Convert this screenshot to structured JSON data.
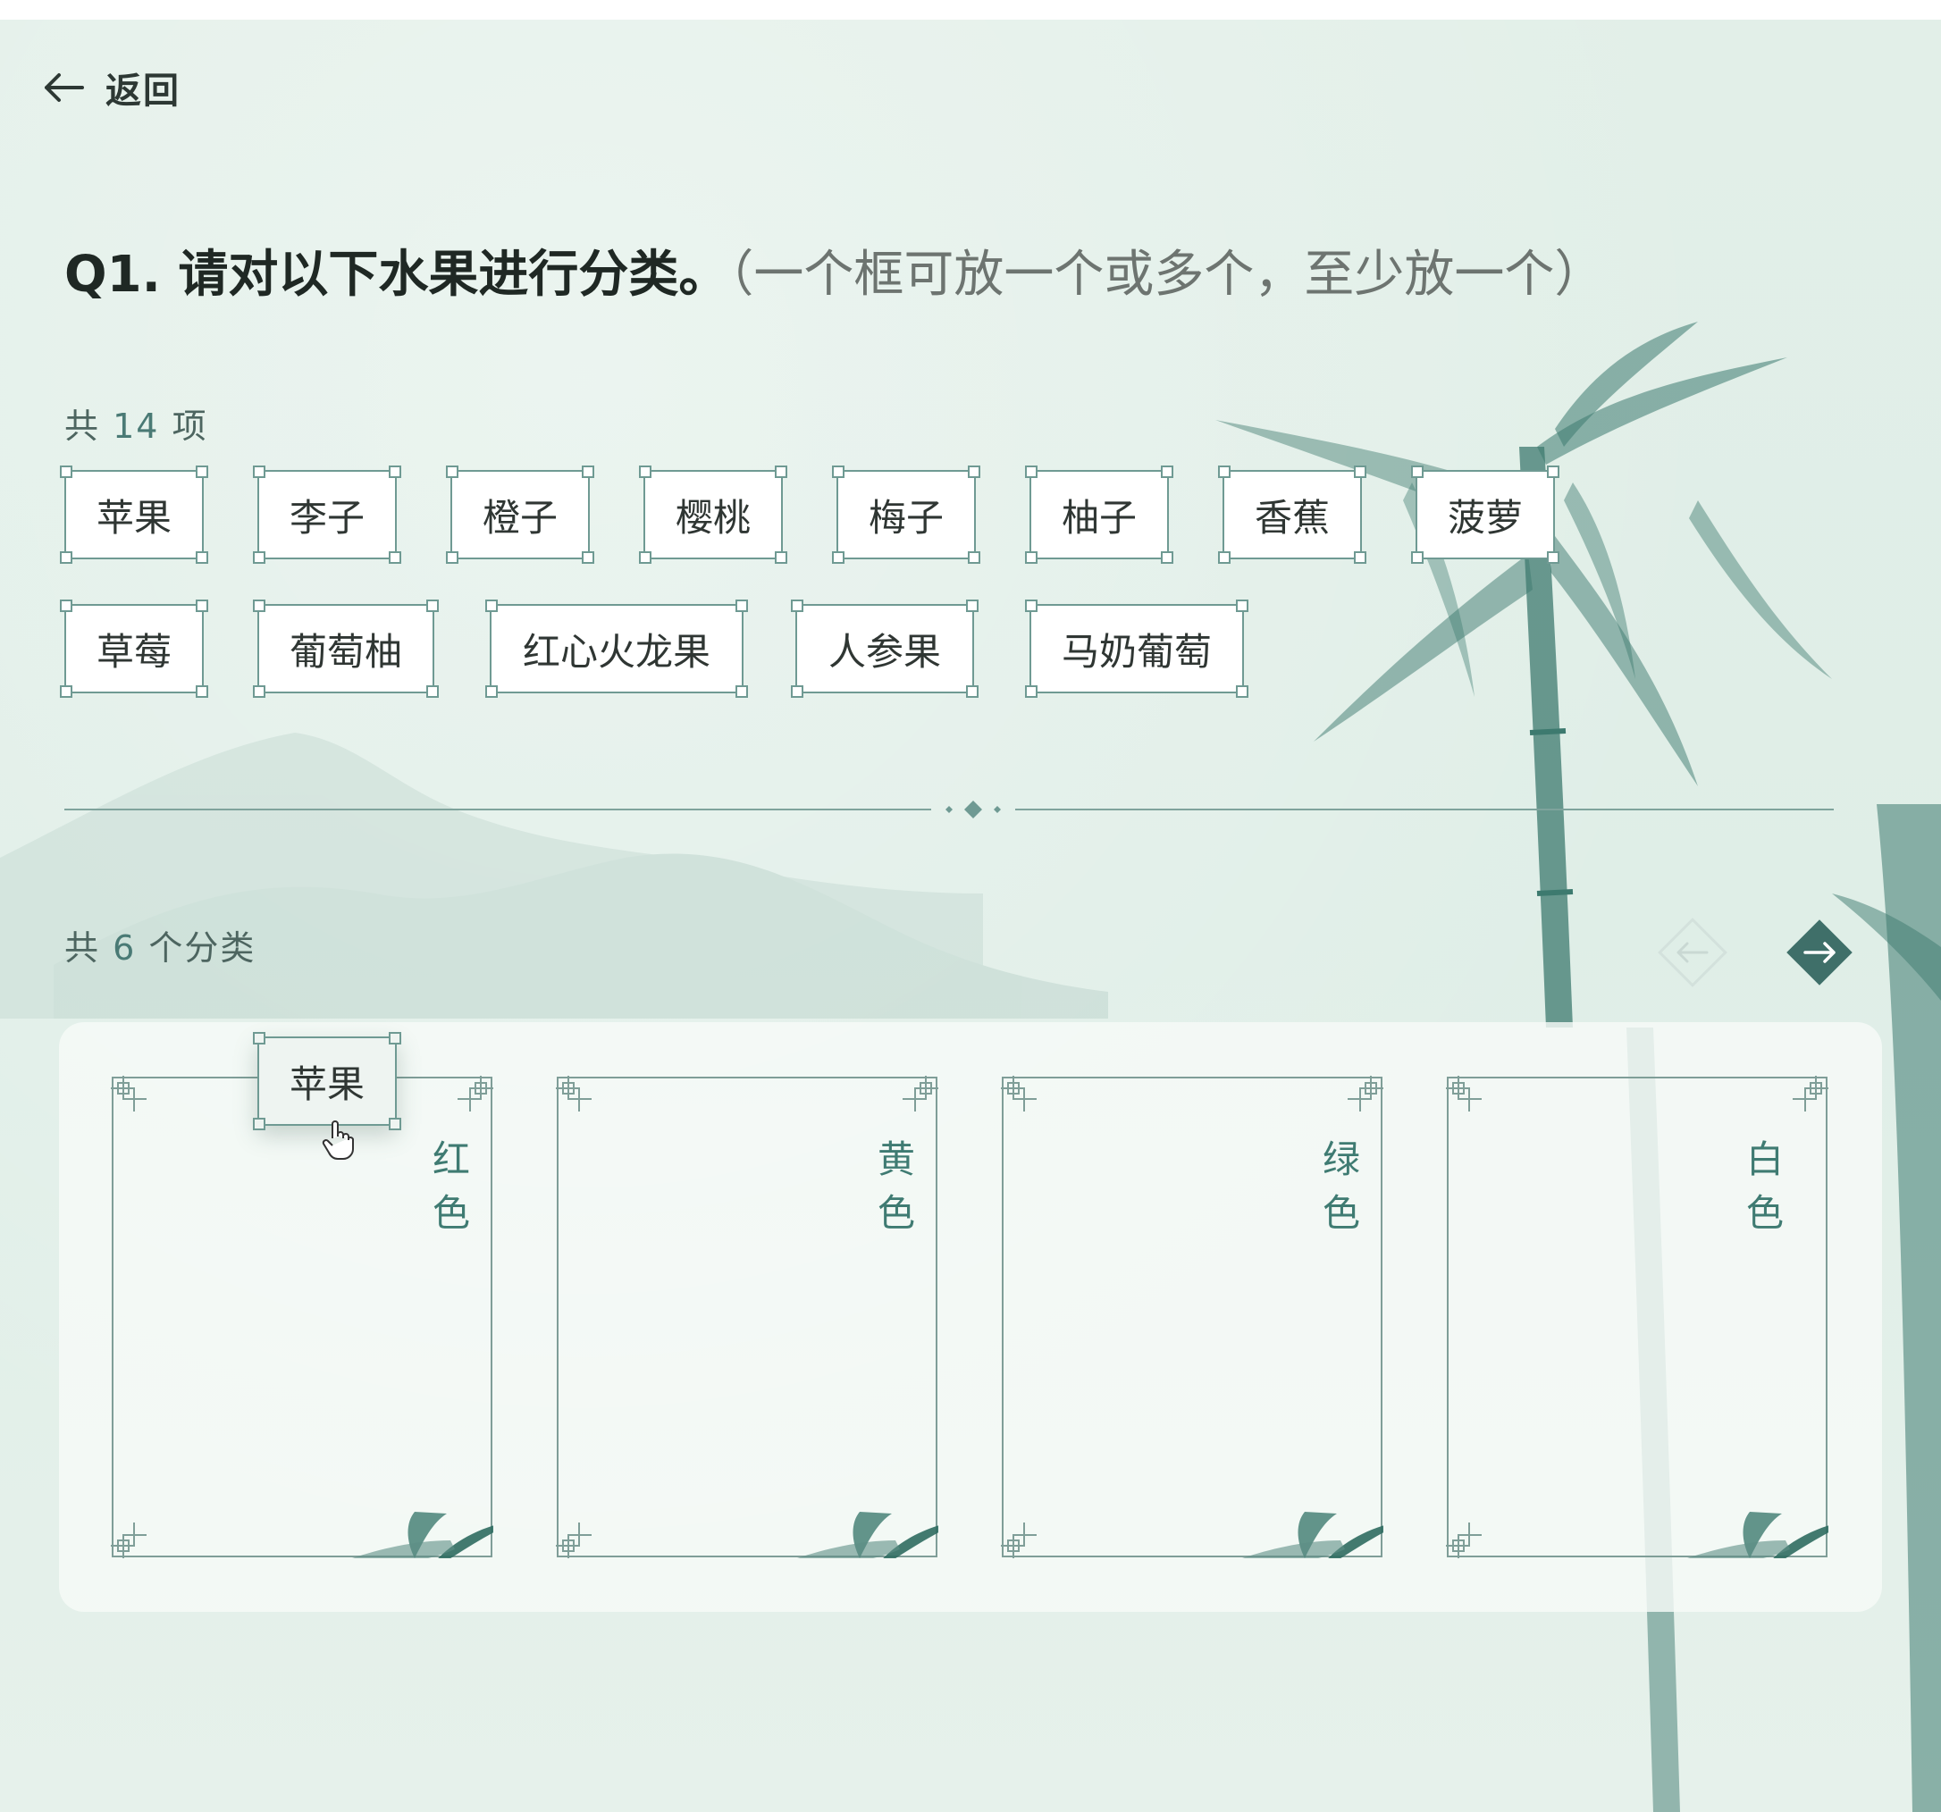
{
  "header": {
    "back_label": "返回"
  },
  "question": {
    "title": "Q1. 请对以下水果进行分类。",
    "hint": "（一个框可放一个或多个，至少放一个）"
  },
  "items_section": {
    "count_prefix": "共",
    "count": "14",
    "count_suffix": "项",
    "items": [
      "苹果",
      "李子",
      "橙子",
      "樱桃",
      "梅子",
      "柚子",
      "香蕉",
      "菠萝",
      "草莓",
      "葡萄柚",
      "红心火龙果",
      "人参果",
      "马奶葡萄"
    ]
  },
  "categories_section": {
    "count_prefix": "共",
    "count": "6",
    "count_suffix": "个分类",
    "boxes": [
      {
        "label_line1": "红",
        "label_line2": "色"
      },
      {
        "label_line1": "黄",
        "label_line2": "色"
      },
      {
        "label_line1": "绿",
        "label_line2": "色"
      },
      {
        "label_line1": "白",
        "label_line2": "色"
      }
    ]
  },
  "dragging_item": {
    "label": "苹果"
  },
  "icons": {
    "back": "arrow-left-icon",
    "prev": "arrow-left-diamond-icon",
    "next": "arrow-right-diamond-icon",
    "cursor": "hand-pointer-icon"
  },
  "colors": {
    "accent": "#4a7a75",
    "frame": "#6f9a93",
    "nav_active": "#3f6f69",
    "background": "#e2efe8"
  }
}
